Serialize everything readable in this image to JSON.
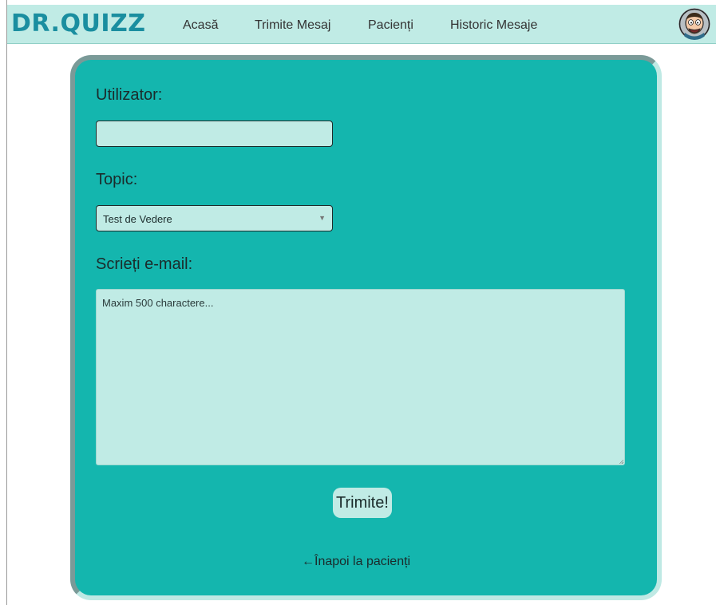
{
  "navbar": {
    "logo": "DR.QUIZZ",
    "links": [
      "Acasă",
      "Trimite Mesaj",
      "Pacienți",
      "Historic Mesaje"
    ],
    "avatar_icon": "profile-avatar-icon"
  },
  "form": {
    "user_label": "Utilizator:",
    "user_value": "",
    "topic_label": "Topic:",
    "topic_selected": "Test de Vedere",
    "email_label": "Scrieți e-mail:",
    "email_placeholder": "Maxim 500 charactere...",
    "submit_label": "Trimite!",
    "back_link": "←Înapoi la pacienți"
  },
  "colors": {
    "card_background": "#14b6ae",
    "navbar_background": "#c0ebe5",
    "logo_color": "#1a8ea0",
    "field_background": "#c0ebe5"
  }
}
